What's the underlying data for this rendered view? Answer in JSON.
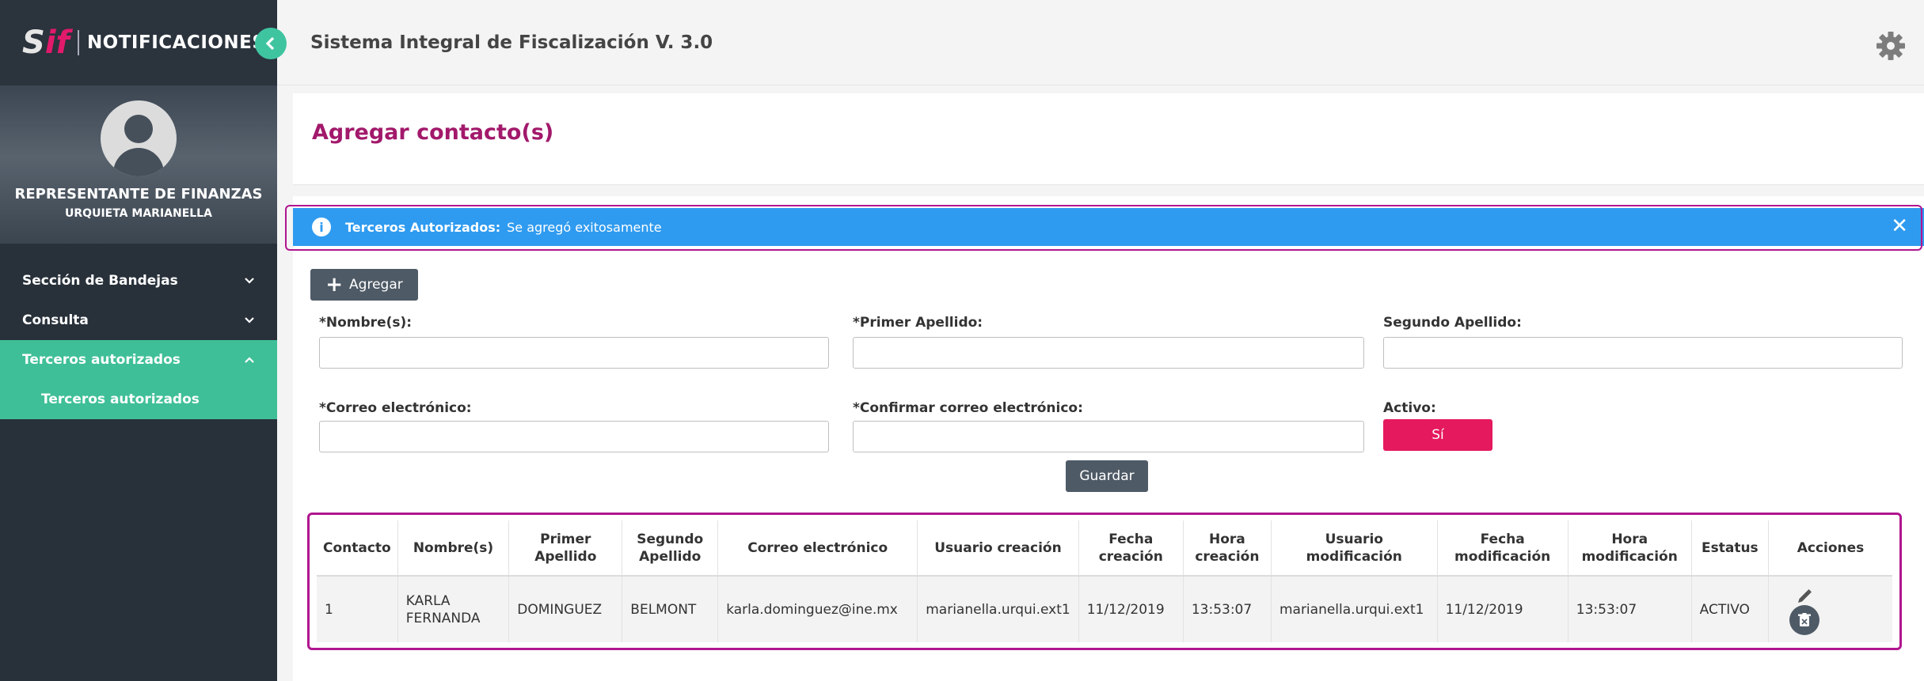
{
  "brand": {
    "logo_s": "S",
    "logo_if": "if",
    "app_title": "NOTIFICACIONES"
  },
  "user": {
    "role": "REPRESENTANTE DE FINANZAS",
    "name": "URQUIETA MARIANELLA"
  },
  "sidebar": {
    "items": [
      {
        "label": "Sección de Bandejas",
        "expanded": false
      },
      {
        "label": "Consulta",
        "expanded": false
      },
      {
        "label": "Terceros autorizados",
        "expanded": true
      }
    ],
    "subitems": [
      {
        "label": "Terceros autorizados"
      }
    ]
  },
  "topbar": {
    "title": "Sistema Integral de Fiscalización V. 3.0",
    "settings_icon": "gear-icon"
  },
  "page": {
    "title": "Agregar contacto(s)"
  },
  "alert": {
    "label": "Terceros Autorizados:",
    "message": "Se agregó exitosamente",
    "close": "✕",
    "color": "#2f9bf0"
  },
  "form": {
    "add_button": "Agregar",
    "nombre_label": "*Nombre(s):",
    "nombre_value": "",
    "primer_apellido_label": "*Primer Apellido:",
    "primer_apellido_value": "",
    "segundo_apellido_label": "Segundo Apellido:",
    "segundo_apellido_value": "",
    "correo_label": "*Correo electrónico:",
    "correo_value": "",
    "confirmar_correo_label": "*Confirmar correo electrónico:",
    "confirmar_correo_value": "",
    "activo_label": "Activo:",
    "activo_value": "Sí",
    "save_button": "Guardar"
  },
  "table": {
    "headers": [
      [
        "Contacto"
      ],
      [
        "Nombre(s)"
      ],
      [
        "Primer",
        "Apellido"
      ],
      [
        "Segundo",
        "Apellido"
      ],
      [
        "Correo electrónico"
      ],
      [
        "Usuario creación"
      ],
      [
        "Fecha",
        "creación"
      ],
      [
        "Hora",
        "creación"
      ],
      [
        "Usuario",
        "modificación"
      ],
      [
        "Fecha",
        "modificación"
      ],
      [
        "Hora",
        "modificación"
      ],
      [
        "Estatus"
      ],
      [
        "Acciones"
      ]
    ],
    "rows": [
      {
        "contacto": "1",
        "nombre_1": "KARLA",
        "nombre_2": "FERNANDA",
        "primer_apellido": "DOMINGUEZ",
        "segundo_apellido": "BELMONT",
        "correo": "karla.dominguez@ine.mx",
        "usuario_creacion": "marianella.urqui.ext1",
        "fecha_creacion": "11/12/2019",
        "hora_creacion": "13:53:07",
        "usuario_modificacion": "marianella.urqui.ext1",
        "fecha_modificacion": "11/12/2019",
        "hora_modificacion": "13:53:07",
        "estatus": "ACTIVO"
      }
    ]
  },
  "colors": {
    "sidebar_bg": "#28313a",
    "accent_green": "#3fbf97",
    "title_magenta": "#a2196b",
    "active_pink": "#e5195e",
    "button_gray": "#4e5a66",
    "highlight_outline": "#b0158f"
  }
}
